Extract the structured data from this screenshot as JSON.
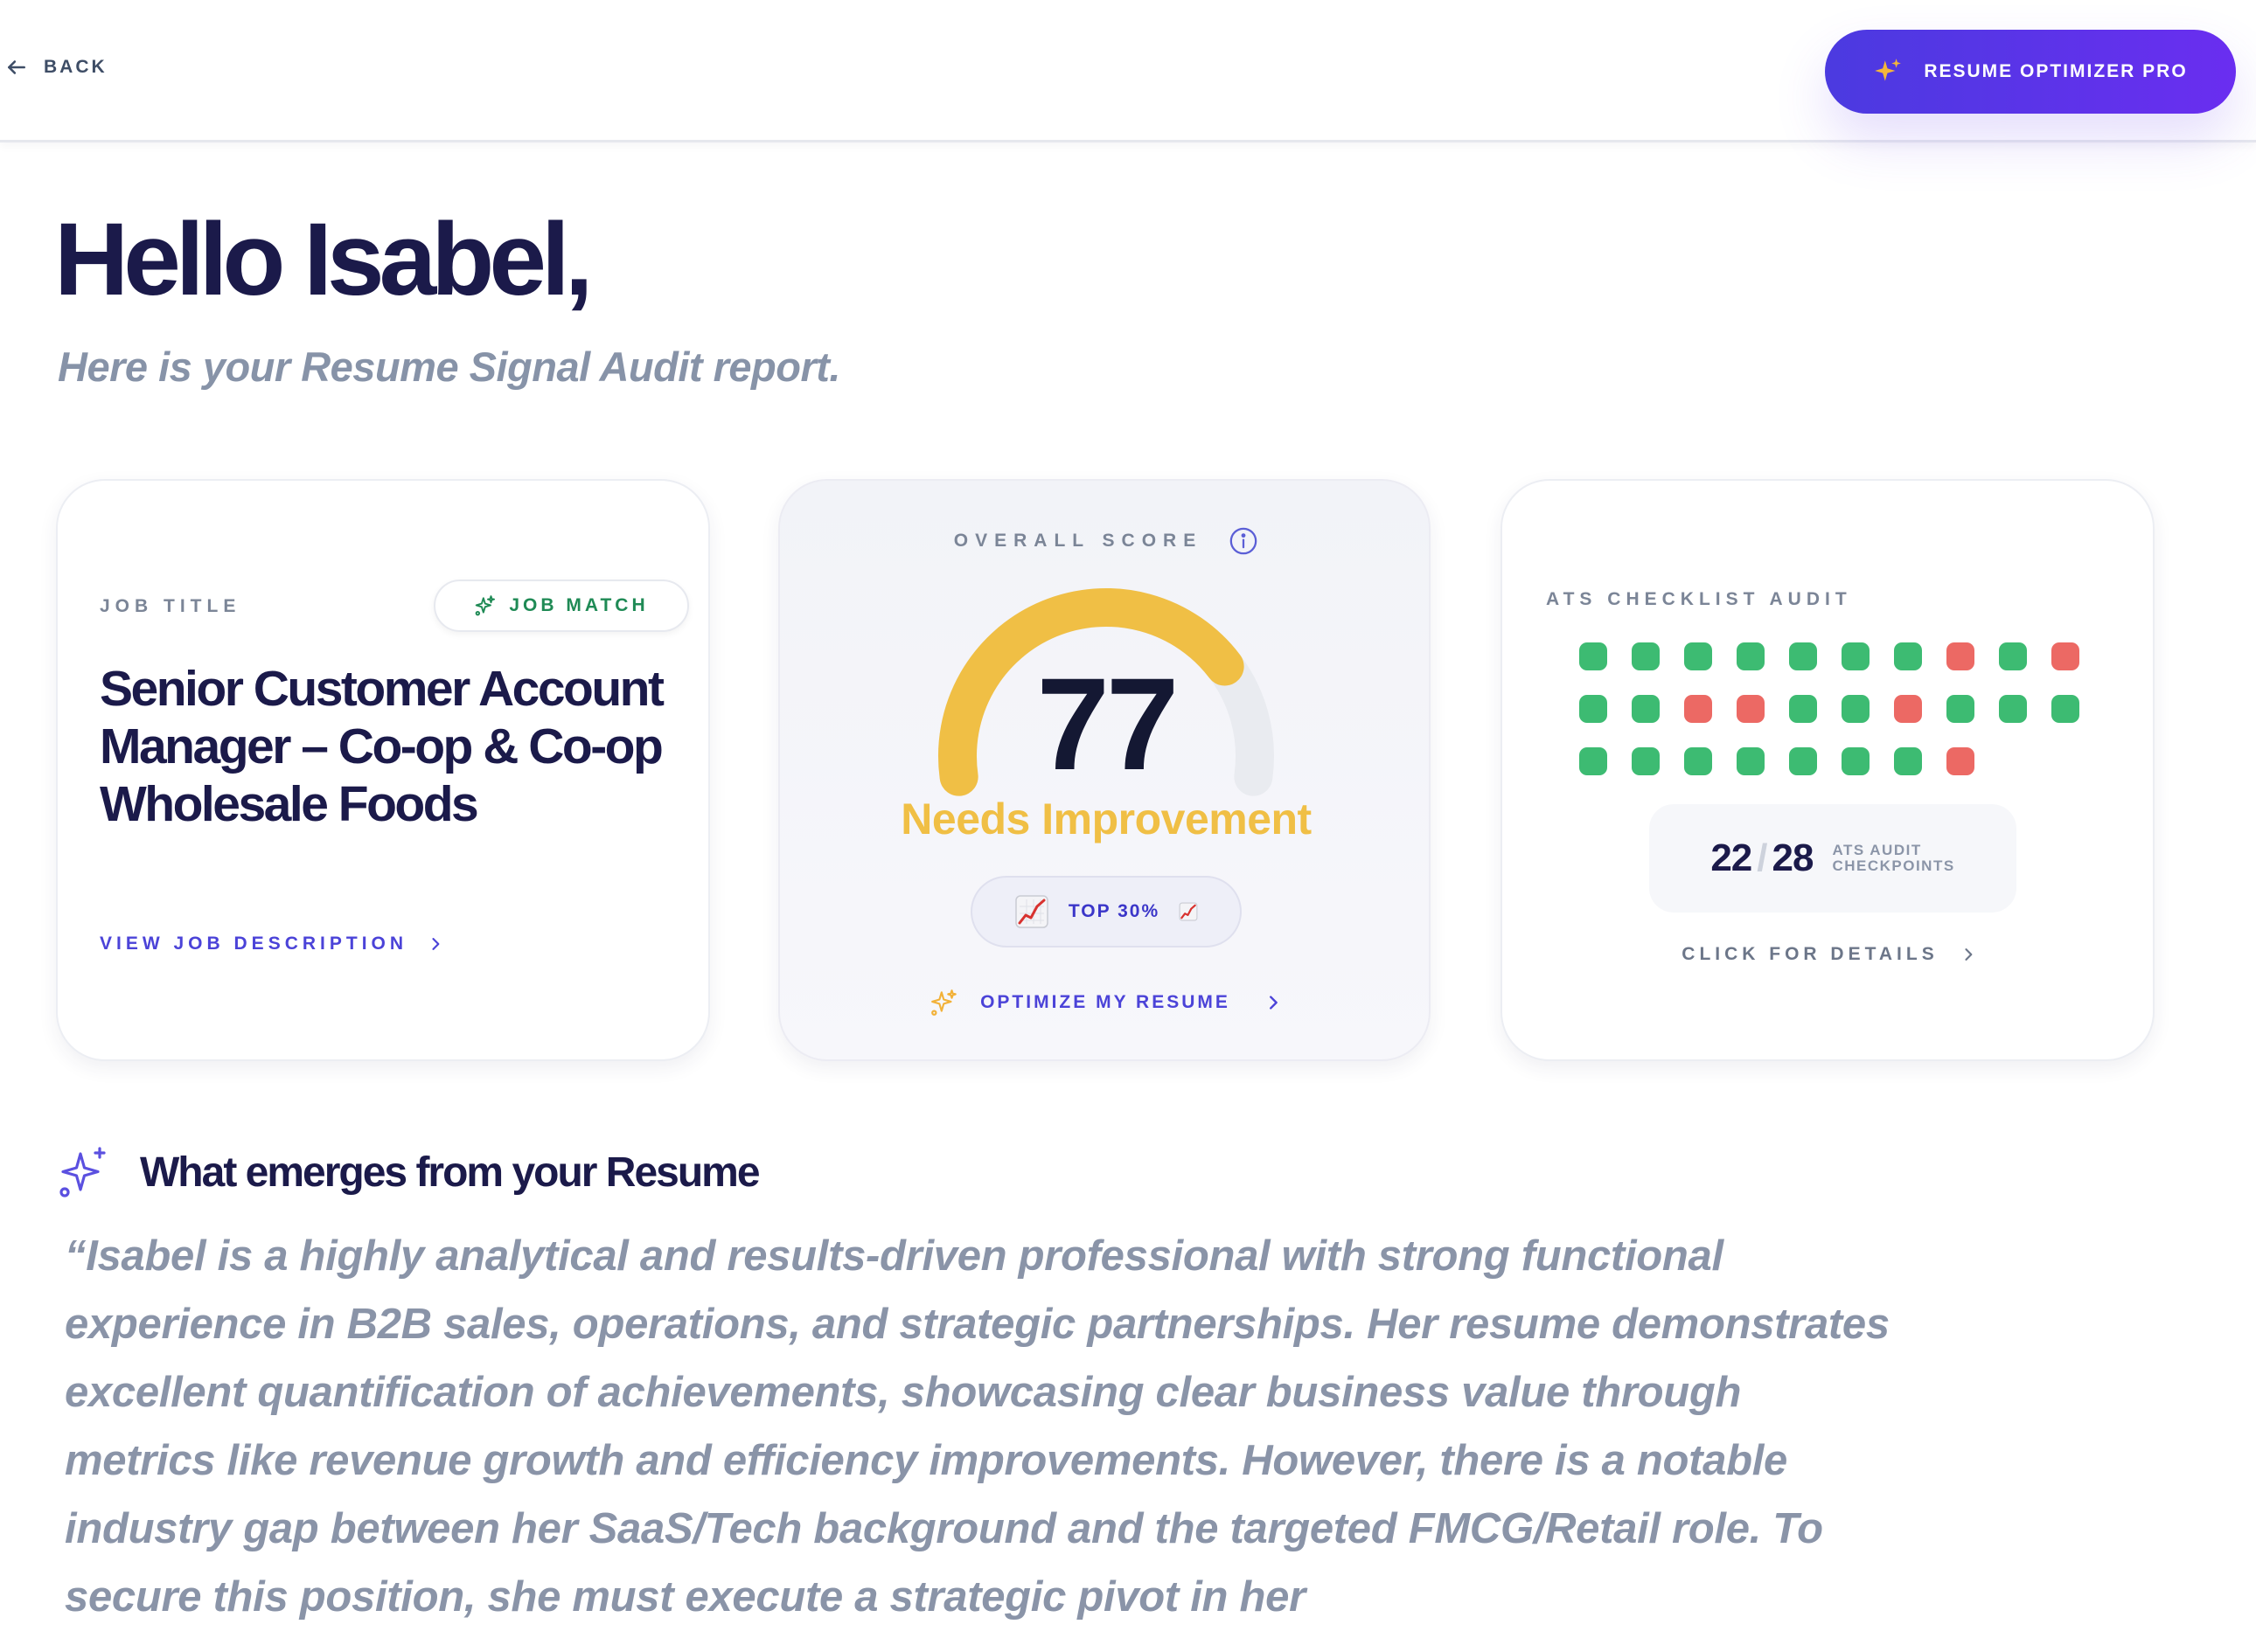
{
  "topbar": {
    "back_label": "BACK",
    "pro_button_label": "RESUME OPTIMIZER PRO"
  },
  "header": {
    "greeting": "Hello Isabel,",
    "subtitle": "Here is your Resume Signal Audit report."
  },
  "job_card": {
    "label": "JOB TITLE",
    "match_badge": "JOB MATCH",
    "title": "Senior Customer Account Manager – Co-op & Co-op Wholesale Foods",
    "link_label": "VIEW JOB DESCRIPTION"
  },
  "score_card": {
    "label": "OVERALL SCORE",
    "score": "77",
    "score_value": 77,
    "score_max": 100,
    "status": "Needs Improvement",
    "rank_pill": "TOP 30%",
    "optimize_label": "OPTIMIZE MY RESUME",
    "colors": {
      "gauge_fill": "#f0bf45",
      "gauge_track": "#e9ebf0"
    }
  },
  "ats_card": {
    "label": "ATS CHECKLIST AUDIT",
    "checks": [
      "pass",
      "pass",
      "pass",
      "pass",
      "pass",
      "pass",
      "pass",
      "fail",
      "pass",
      "fail",
      "pass",
      "pass",
      "fail",
      "fail",
      "pass",
      "pass",
      "fail",
      "pass",
      "pass",
      "pass",
      "pass",
      "pass",
      "pass",
      "pass",
      "pass",
      "pass",
      "pass",
      "fail"
    ],
    "passed": "22",
    "total": "28",
    "caption_line1": "ATS AUDIT",
    "caption_line2": "CHECKPOINTS",
    "details_label": "CLICK FOR DETAILS",
    "colors": {
      "pass": "#3dbb72",
      "fail": "#ec6964"
    }
  },
  "section": {
    "title": "What emerges from your Resume",
    "summary": "“Isabel is a highly analytical and results-driven professional with strong functional experience in B2B sales, operations, and strategic partnerships. Her resume demonstrates excellent quantification of achievements, showcasing clear business value through metrics like revenue growth and efficiency improvements. However, there is a notable industry gap between her SaaS/Tech background and the targeted FMCG/Retail role. To secure this position, she must execute a strategic pivot in her"
  }
}
